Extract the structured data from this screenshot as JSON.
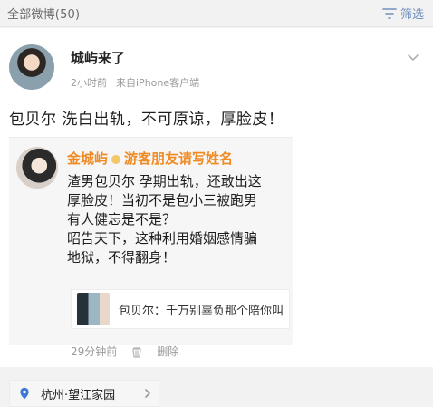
{
  "header": {
    "title": "全部微博(50)",
    "filter_label": "筛选"
  },
  "post": {
    "author": "城屿来了",
    "time": "2小时前",
    "source": "来自iPhone客户端",
    "text": "包贝尔 洗白出轨，不可原谅，厚脸皮！",
    "location": "杭州·望江家园"
  },
  "repost": {
    "author": "金城屿",
    "author_suffix": "游客朋友请写姓名",
    "lines": [
      "渣男包贝尔 孕期出轨，还敢出这",
      "厚脸皮！当初不是包小三被跑男",
      "有人健忘是不是？",
      "昭告天下，这种利用婚姻感情骗",
      "地狱，不得翻身！"
    ],
    "link_title": "包贝尔：千万别辜负那个陪你叫",
    "time": "29分钟前",
    "delete_label": "删除"
  },
  "colors": {
    "accent_orange": "#f08a22",
    "accent_blue": "#6f8fbd",
    "muted": "#9a9a9a"
  },
  "icons": {
    "filter": "filter-icon",
    "chevron": "chevron-down-icon",
    "location": "location-pin-icon",
    "delete": "trash-icon"
  }
}
